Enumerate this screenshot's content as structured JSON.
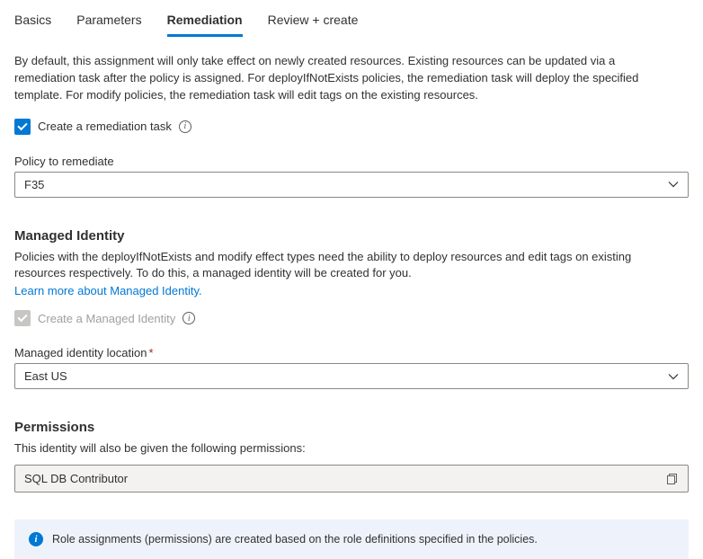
{
  "tabs": {
    "basics": "Basics",
    "parameters": "Parameters",
    "remediation": "Remediation",
    "review": "Review + create"
  },
  "intro": "By default, this assignment will only take effect on newly created resources. Existing resources can be updated via a remediation task after the policy is assigned. For deployIfNotExists policies, the remediation task will deploy the specified template. For modify policies, the remediation task will edit tags on the existing resources.",
  "createTask": {
    "label": "Create a remediation task",
    "checked": true
  },
  "policyToRemediate": {
    "label": "Policy to remediate",
    "value": "F35"
  },
  "managedIdentity": {
    "title": "Managed Identity",
    "desc": "Policies with the deployIfNotExists and modify effect types need the ability to deploy resources and edit tags on existing resources respectively. To do this, a managed identity will be created for you.",
    "link": "Learn more about Managed Identity.",
    "checkboxLabel": "Create a Managed Identity"
  },
  "location": {
    "label": "Managed identity location",
    "value": "East US",
    "required": "*"
  },
  "permissions": {
    "title": "Permissions",
    "desc": "This identity will also be given the following permissions:",
    "value": "SQL DB Contributor"
  },
  "banner": "Role assignments (permissions) are created based on the role definitions specified in the policies."
}
